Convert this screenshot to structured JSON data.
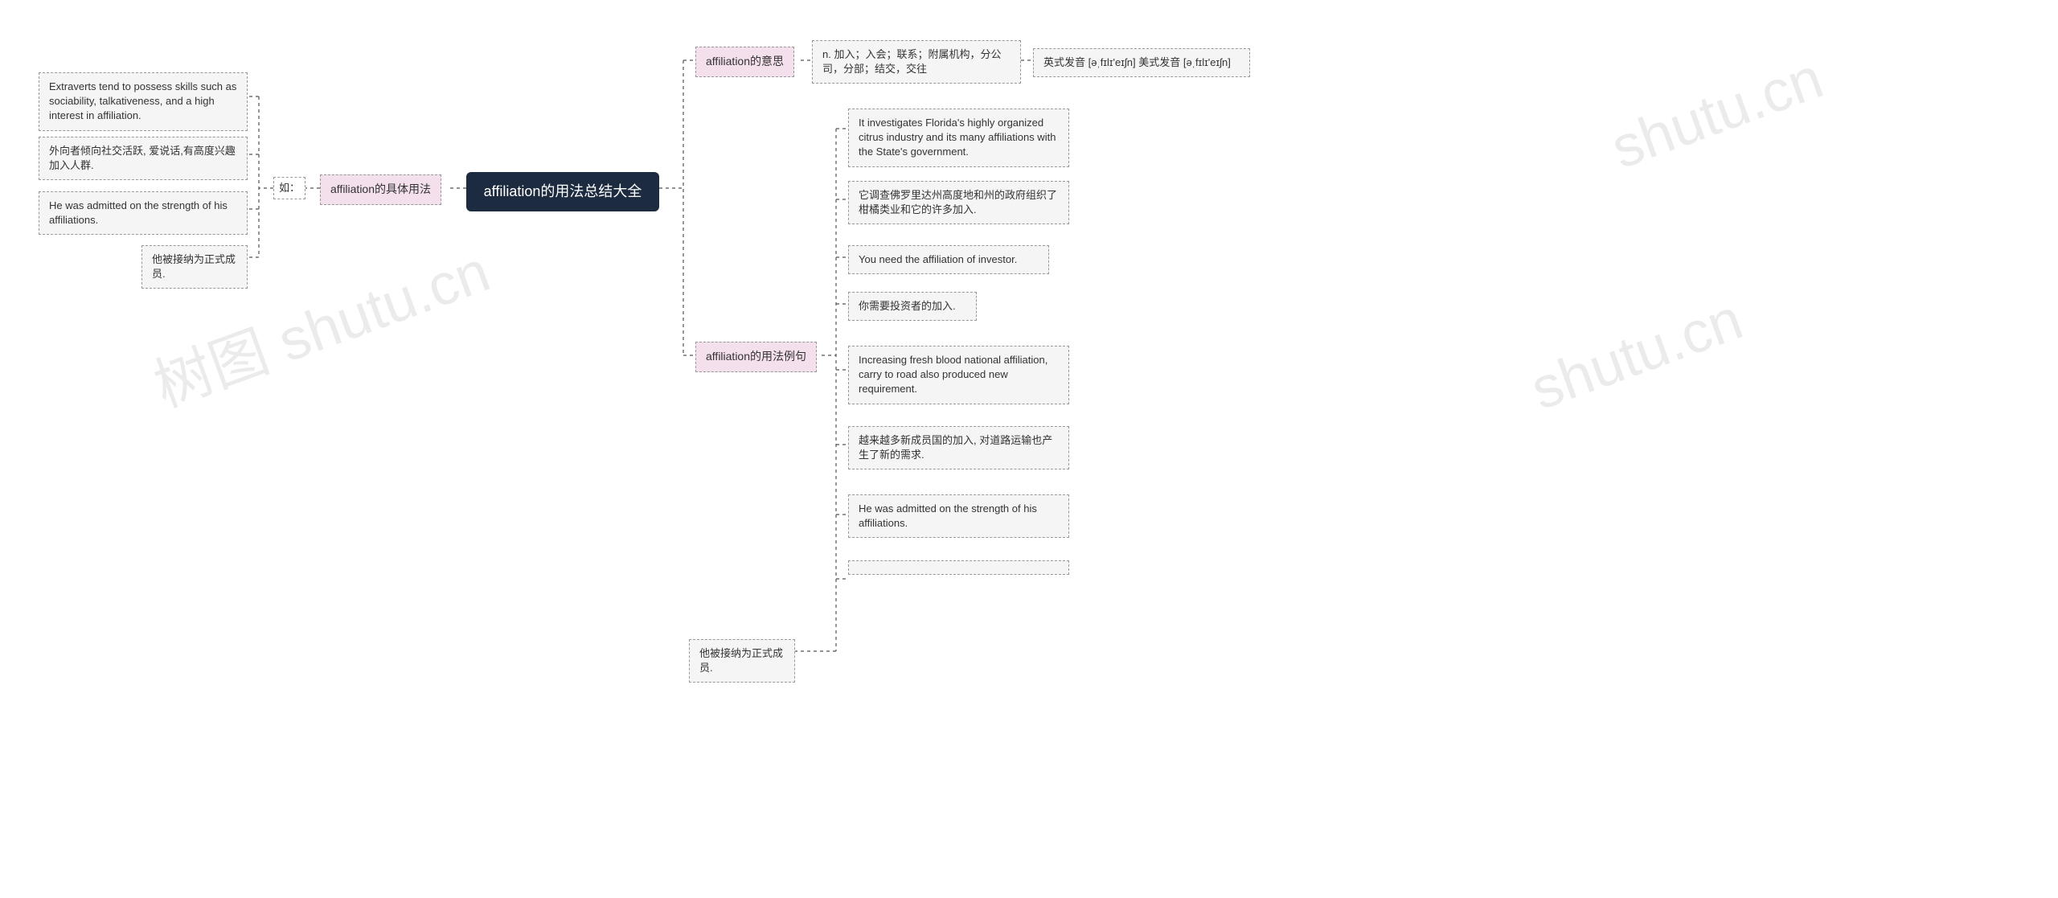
{
  "root": "affiliation的用法总结大全",
  "branches": {
    "meaning": {
      "label": "affiliation的意思",
      "definition": "n. 加入；入会；联系；附属机构，分公司，分部；结交，交往",
      "pronunciation": "英式发音 [əˌfɪlɪ'eɪʃn] 美式发音 [əˌfɪlɪ'eɪʃn]"
    },
    "examples": {
      "label": "affiliation的用法例句",
      "items": [
        "It investigates Florida's highly organized citrus industry and its many affiliations with the State's government.",
        "它调查佛罗里达州高度地和州的政府组织了柑橘类业和它的许多加入.",
        "You need the affiliation of investor.",
        "你需要投资者的加入.",
        "Increasing fresh blood national affiliation, carry to road also produced new requirement.",
        "越来越多新成员国的加入, 对道路运输也产生了新的需求.",
        "He was admitted on the strength of his affiliations.",
        "他被接纳为正式成员."
      ]
    },
    "usage": {
      "label": "affiliation的具体用法",
      "connector": "如：",
      "items": [
        "Extraverts tend to possess skills such as sociability, talkativeness, and a high interest in affiliation.",
        "外向者倾向社交活跃, 爱说话,有高度兴趣加入人群.",
        "He was admitted on the strength of his affiliations.",
        "他被接纳为正式成员."
      ]
    }
  },
  "watermark": "树图 shutu.cn",
  "watermark_short": "shutu.cn"
}
